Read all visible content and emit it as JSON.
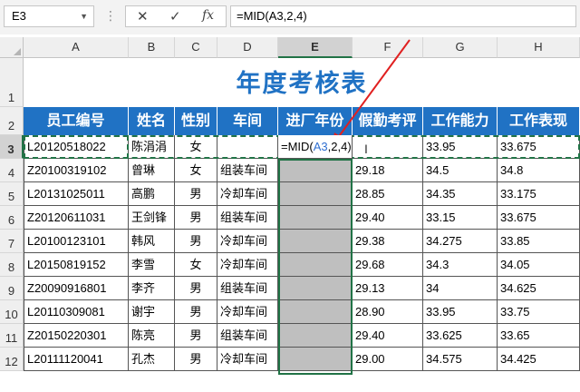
{
  "formula_bar": {
    "name_box": "E3",
    "cancel_icon": "✕",
    "enter_icon": "✓",
    "fx_label": "fx",
    "formula": "=MID(A3,2,4)"
  },
  "columns": [
    "A",
    "B",
    "C",
    "D",
    "E",
    "F",
    "G",
    "H"
  ],
  "selected_column": "E",
  "rows": [
    "1",
    "2",
    "3",
    "4",
    "5",
    "6",
    "7",
    "8",
    "9",
    "10",
    "11",
    "12"
  ],
  "selected_row": "3",
  "sheet": {
    "title": "年度考核表",
    "headers": [
      "员工编号",
      "姓名",
      "性别",
      "车间",
      "进厂年份",
      "假勤考评",
      "工作能力",
      "工作表现"
    ],
    "editing_formula": {
      "prefix": "=MID(",
      "ref": "A3",
      "suffix": ",2,4)"
    },
    "data": [
      {
        "id": "L20120518022",
        "name": "陈涓涓",
        "gender": "女",
        "workshop": "",
        "year": "",
        "attendance": "",
        "ability": "33.95",
        "performance": "33.675"
      },
      {
        "id": "Z20100319102",
        "name": "曾琳",
        "gender": "女",
        "workshop": "组装车间",
        "year": "",
        "attendance": "29.18",
        "ability": "34.5",
        "performance": "34.8"
      },
      {
        "id": "L20131025011",
        "name": "高鹏",
        "gender": "男",
        "workshop": "冷却车间",
        "year": "",
        "attendance": "28.85",
        "ability": "34.35",
        "performance": "33.175"
      },
      {
        "id": "Z20120611031",
        "name": "王剑锋",
        "gender": "男",
        "workshop": "组装车间",
        "year": "",
        "attendance": "29.40",
        "ability": "33.15",
        "performance": "33.675"
      },
      {
        "id": "L20100123101",
        "name": "韩风",
        "gender": "男",
        "workshop": "冷却车间",
        "year": "",
        "attendance": "29.38",
        "ability": "34.275",
        "performance": "33.85"
      },
      {
        "id": "L20150819152",
        "name": "李雪",
        "gender": "女",
        "workshop": "冷却车间",
        "year": "",
        "attendance": "29.68",
        "ability": "34.3",
        "performance": "34.05"
      },
      {
        "id": "Z20090916801",
        "name": "李齐",
        "gender": "男",
        "workshop": "组装车间",
        "year": "",
        "attendance": "29.13",
        "ability": "34",
        "performance": "34.625"
      },
      {
        "id": "L20110309081",
        "name": "谢宇",
        "gender": "男",
        "workshop": "冷却车间",
        "year": "",
        "attendance": "28.90",
        "ability": "33.95",
        "performance": "33.75"
      },
      {
        "id": "Z20150220301",
        "name": "陈亮",
        "gender": "男",
        "workshop": "组装车间",
        "year": "",
        "attendance": "29.40",
        "ability": "33.625",
        "performance": "33.65"
      },
      {
        "id": "L20111120041",
        "name": "孔杰",
        "gender": "男",
        "workshop": "冷却车间",
        "year": "",
        "attendance": "29.00",
        "ability": "34.575",
        "performance": "34.425"
      }
    ]
  },
  "colors": {
    "header_bg": "#2072c4",
    "title": "#2072c4",
    "selection": "#217346",
    "filled_cell": "#bfbfbf",
    "arrow": "#e02020"
  }
}
